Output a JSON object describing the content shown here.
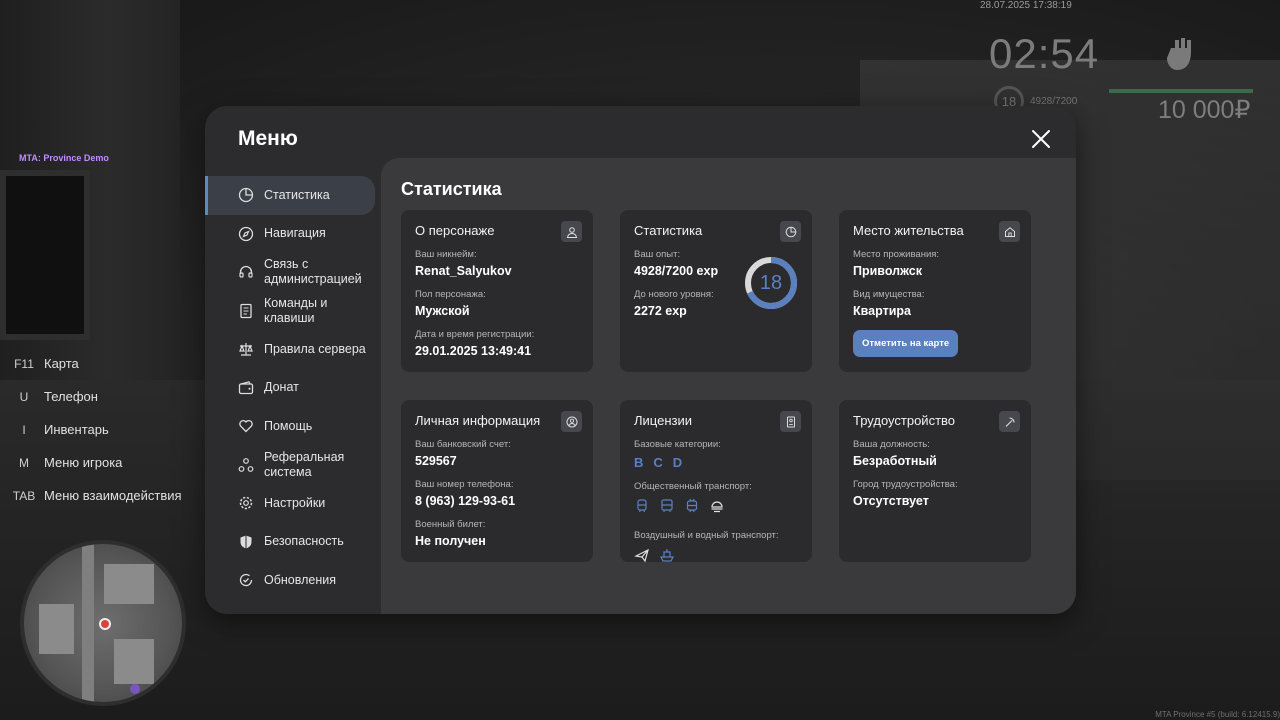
{
  "hud": {
    "server_tag": "MTA: Province Demo",
    "datetime": "28.07.2025 17:38:19",
    "clock": "02:54",
    "level": "18",
    "exp": "4928/7200",
    "money": "10 000₽",
    "build_info": "MTA Province #5 (build: 6.12415.9)",
    "keys": [
      {
        "key": "F11",
        "label": "Карта"
      },
      {
        "key": "U",
        "label": "Телефон"
      },
      {
        "key": "I",
        "label": "Инвентарь"
      },
      {
        "key": "M",
        "label": "Меню игрока"
      },
      {
        "key": "TAB",
        "label": "Меню взаимодействия"
      }
    ]
  },
  "menu": {
    "title": "Меню",
    "sidebar": [
      {
        "label": "Статистика",
        "icon": "pie-chart-icon",
        "active": true
      },
      {
        "label": "Навигация",
        "icon": "compass-icon"
      },
      {
        "label": "Связь с администрацией",
        "icon": "headset-icon"
      },
      {
        "label": "Команды и клавиши",
        "icon": "document-icon"
      },
      {
        "label": "Правила сервера",
        "icon": "scales-icon"
      },
      {
        "label": "Донат",
        "icon": "wallet-icon"
      },
      {
        "label": "Помощь",
        "icon": "heart-hands-icon"
      },
      {
        "label": "Реферальная система",
        "icon": "people-network-icon"
      },
      {
        "label": "Настройки",
        "icon": "gear-icon"
      },
      {
        "label": "Безопасность",
        "icon": "shield-icon"
      },
      {
        "label": "Обновления",
        "icon": "refresh-check-icon"
      }
    ],
    "content_title": "Статистика",
    "character": {
      "title": "О персонаже",
      "nick_label": "Ваш никнейм:",
      "nick": "Renat_Salyukov",
      "gender_label": "Пол персонажа:",
      "gender": "Мужской",
      "reg_label": "Дата и время регистрации:",
      "reg": "29.01.2025 13:49:41"
    },
    "stats": {
      "title": "Статистика",
      "exp_label": "Ваш опыт:",
      "exp": "4928/7200 exp",
      "next_label": "До нового уровня:",
      "next": "2272 exp",
      "level": "18",
      "progress": 0.684
    },
    "residence": {
      "title": "Место жительства",
      "place_label": "Место проживания:",
      "place": "Приволжск",
      "type_label": "Вид имущества:",
      "type": "Квартира",
      "button": "Отметить на карте"
    },
    "personal": {
      "title": "Личная информация",
      "bank_label": "Ваш банковский счет:",
      "bank": "529567",
      "phone_label": "Ваш номер телефона:",
      "phone": "8 (963) 129-93-61",
      "military_label": "Военный билет:",
      "military": "Не получен"
    },
    "licenses": {
      "title": "Лицензии",
      "basic_label": "Базовые категории:",
      "categories": [
        "B",
        "C",
        "D"
      ],
      "public_label": "Общественный транспорт:",
      "air_label": "Воздушный и водный транспорт:"
    },
    "employment": {
      "title": "Трудоустройство",
      "position_label": "Ваша должность:",
      "position": "Безработный",
      "city_label": "Город трудоустройства:",
      "city": "Отсутствует"
    }
  },
  "colors": {
    "accent": "#5b80bf",
    "panel": "#2c2c2f",
    "content": "#3a3a3d",
    "card": "#2b2b2e"
  }
}
